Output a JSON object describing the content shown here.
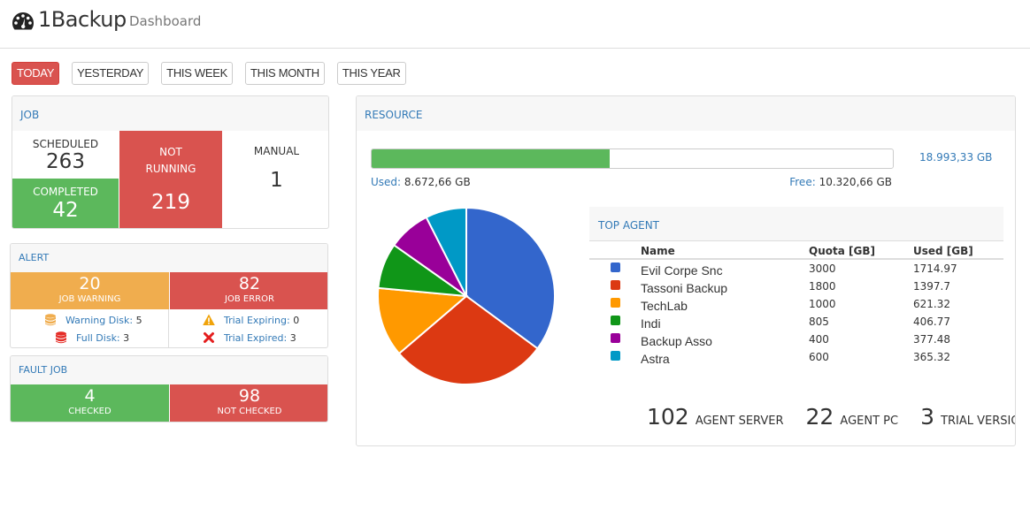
{
  "header": {
    "icon": "dashboard-gauge-icon",
    "app_title": "1Backup",
    "page_subtitle": "Dashboard"
  },
  "range_tabs": [
    {
      "label": "TODAY",
      "active": true
    },
    {
      "label": "YESTERDAY",
      "active": false
    },
    {
      "label": "THIS WEEK",
      "active": false
    },
    {
      "label": "THIS MONTH",
      "active": false
    },
    {
      "label": "THIS YEAR",
      "active": false
    }
  ],
  "job": {
    "title": "JOB",
    "scheduled": {
      "label": "SCHEDULED",
      "value": "263"
    },
    "completed": {
      "label": "COMPLETED",
      "value": "42"
    },
    "not_running": {
      "label": "NOT RUNNING",
      "value": "219"
    },
    "manual": {
      "label": "MANUAL",
      "value": "1"
    }
  },
  "alert": {
    "title": "ALERT",
    "job_warning": {
      "label": "JOB WARNING",
      "value": "20"
    },
    "job_error": {
      "label": "JOB ERROR",
      "value": "82"
    },
    "warning_disk": {
      "label": "Warning Disk:",
      "value": "5",
      "icon": "database-icon",
      "color": "#f0ad4e"
    },
    "full_disk": {
      "label": "Full Disk:",
      "value": "3",
      "icon": "database-icon",
      "color": "#e52d27"
    },
    "trial_expiring": {
      "label": "Trial Expiring:",
      "value": "0",
      "icon": "warning-triangle-icon",
      "color": "#f0a30a"
    },
    "trial_expired": {
      "label": "Trial Expired:",
      "value": "3",
      "icon": "close-x-icon",
      "color": "#e41e1e"
    }
  },
  "fault_job": {
    "title": "FAULT JOB",
    "checked": {
      "label": "CHECKED",
      "value": "4"
    },
    "not_checked": {
      "label": "NOT CHECKED",
      "value": "98"
    }
  },
  "resource": {
    "title": "RESOURCE",
    "total": "18.993,33 GB",
    "used_label": "Used:",
    "used_value": "8.672,66 GB",
    "free_label": "Free:",
    "free_value": "10.320,66 GB",
    "used_fraction": 0.4566
  },
  "top_agent": {
    "title": "TOP AGENT",
    "columns": [
      "Name",
      "Quota [GB]",
      "Used [GB]"
    ],
    "rows": [
      {
        "name": "Evil Corpe Snc",
        "quota": "3000",
        "used": "1714.97",
        "color": "#3366cc"
      },
      {
        "name": "Tassoni Backup",
        "quota": "1800",
        "used": "1397.7",
        "color": "#dc3912"
      },
      {
        "name": "TechLab",
        "quota": "1000",
        "used": "621.32",
        "color": "#ff9900"
      },
      {
        "name": "Indi",
        "quota": "805",
        "used": "406.77",
        "color": "#109618"
      },
      {
        "name": "Backup Asso",
        "quota": "400",
        "used": "377.48",
        "color": "#990099"
      },
      {
        "name": "Astra",
        "quota": "600",
        "used": "365.32",
        "color": "#0099c6"
      }
    ]
  },
  "agent_counts": [
    {
      "value": "102",
      "label": "AGENT SERVER"
    },
    {
      "value": "22",
      "label": "AGENT PC"
    },
    {
      "value": "3",
      "label": "TRIAL VERSION"
    }
  ],
  "chart_data": {
    "type": "pie",
    "title": "",
    "categories": [
      "Evil Corpe Snc",
      "Tassoni Backup",
      "TechLab",
      "Indi",
      "Backup Asso",
      "Astra"
    ],
    "values": [
      1714.97,
      1397.7,
      621.32,
      406.77,
      377.48,
      365.32
    ],
    "colors": [
      "#3366cc",
      "#dc3912",
      "#ff9900",
      "#109618",
      "#990099",
      "#0099c6"
    ],
    "legend": "table-right",
    "start_angle": "top, clockwise"
  }
}
